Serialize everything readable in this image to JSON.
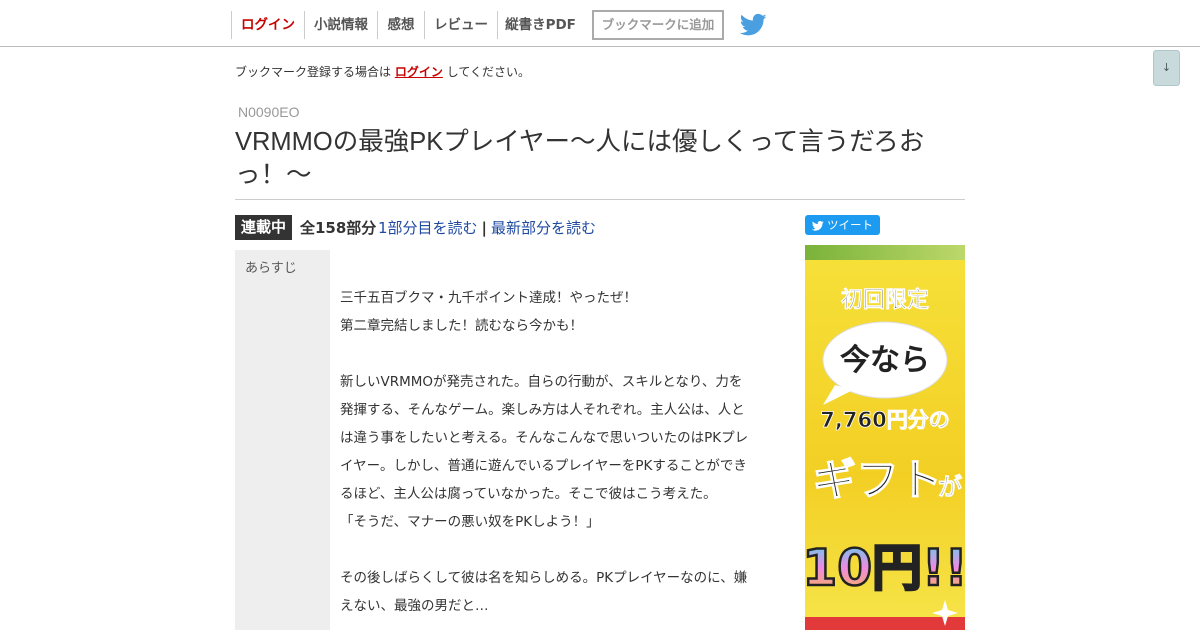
{
  "nav": {
    "login": "ログイン",
    "novel_info": "小説情報",
    "impressions": "感想",
    "review": "レビュー",
    "vertical_pdf": "縦書きPDF",
    "bookmark_add": "ブックマークに追加",
    "twitter_icon": "twitter-bird-icon"
  },
  "scroll_button": "↓",
  "bookmark_notice": {
    "prefix": "ブックマーク登録する場合は",
    "link": "ログイン",
    "suffix": "してください。"
  },
  "novel": {
    "ncode": "N0090EO",
    "title": "VRMMOの最強PKプレイヤー〜人には優しくって言うだろおっ！〜",
    "status_badge": "連載中",
    "episode_count": "全158部分",
    "read_first": "1部分目を読む",
    "separator": "|",
    "read_latest": "最新部分を読む"
  },
  "tweet_button": "ツイート",
  "synopsis": {
    "label": "あらすじ",
    "lines": [
      "三千五百ブクマ・九千ポイント達成！やったぜ！",
      "第二章完結しました！読むなら今かも！",
      "",
      "新しいVRMMOが発売された。自らの行動が、スキルとなり、力を",
      "発揮する、そんなゲーム。楽しみ方は人それぞれ。主人公は、人と",
      "は違う事をしたいと考える。そんなこんなで思いついたのはPKプレ",
      "イヤー。しかし、普通に遊んでいるプレイヤーをPKすることができ",
      "るほど、主人公は腐っていなかった。そこで彼はこう考えた。",
      "「そうだ、マナーの悪い奴をPKしよう！」",
      "",
      "その後しばらくして彼は名を知らしめる。PKプレイヤーなのに、嫌",
      "えない、最強の男だと…"
    ]
  },
  "ad": {
    "line1": "初回限定",
    "line2": "今なら",
    "line3": "7,760円分の",
    "line4a": "ギフト",
    "line4b": "が",
    "line5": "10円!!"
  },
  "colors": {
    "login_red": "#c80000",
    "link_blue": "#1f4aa0",
    "twitter_blue": "#1d9bf0",
    "badge_dark": "#333333"
  }
}
